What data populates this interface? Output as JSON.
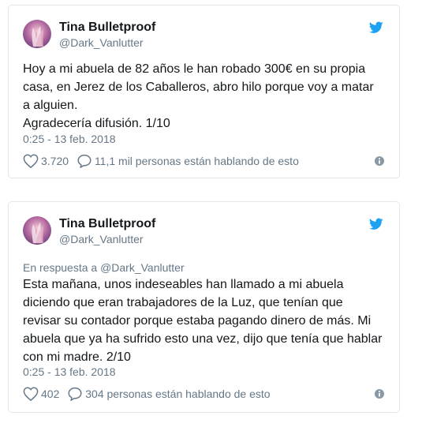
{
  "tweets": [
    {
      "author_name": "Tina Bulletproof",
      "author_handle": "@Dark_Vanlutter",
      "text": "Hoy a mi abuela de 82 años le han robado 300€ en su propia\ncasa, en Jerez de los Caballeros, abro hilo porque voy a matar\na alguien.\n Agradecería difusión. 1/10",
      "timestamp": "0:25 - 13 feb. 2018",
      "likes": "3.720",
      "conversation": "11,1 mil personas están hablando de esto"
    },
    {
      "author_name": "Tina Bulletproof",
      "author_handle": "@Dark_Vanlutter",
      "reply_prefix": "En respuesta a",
      "reply_handle": "@Dark_Vanlutter",
      "text": "Esta mañana, unos indeseables han llamado a mi abuela\ndiciendo que eran trabajadores de la Luz, que tenían que\nrevisar su contador porque estaba pagando dinero de más. Mi\nabuela que ya ha sufrido esto una vez, dijo que tenía que hablar\ncon mi madre. 2/10",
      "timestamp": "0:25 - 13 feb. 2018",
      "likes": "402",
      "conversation": "304 personas están hablando de esto"
    }
  ],
  "colors": {
    "brand": "#1da1f2",
    "text": "#14171a",
    "secondary": "#657786",
    "border": "#e1e8ed"
  },
  "icons": [
    "twitter-bird-icon",
    "heart-icon",
    "reply-bubble-icon",
    "info-icon"
  ]
}
